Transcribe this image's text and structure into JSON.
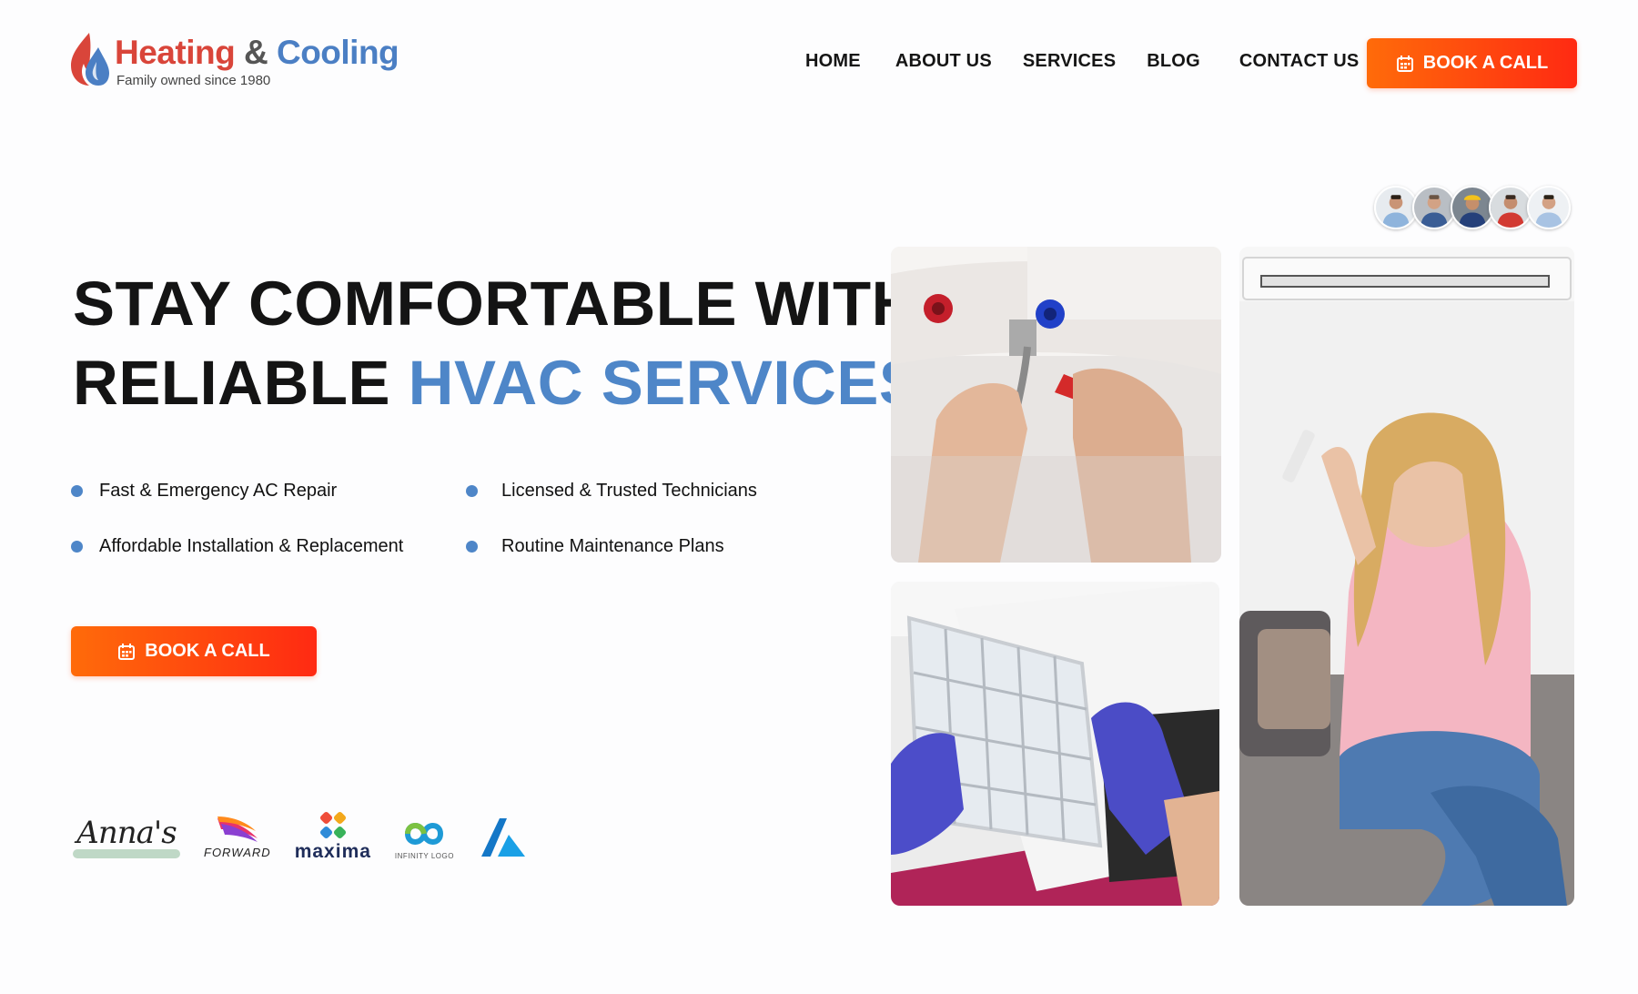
{
  "brand": {
    "title_part1": "Heating",
    "title_amp": " & ",
    "title_part2": "Cooling",
    "tagline": "Family owned since 1980",
    "logo_icon": "flame-drop-icon"
  },
  "nav": {
    "items": [
      "HOME",
      "ABOUT US",
      "SERVICES",
      "BLOG",
      "CONTACT US"
    ],
    "cta_label": "BOOK A CALL",
    "cta_icon": "calendar-icon"
  },
  "hero": {
    "headline_line1": "STAY COMFORTABLE WITH",
    "headline_line2_plain": "RELIABLE ",
    "headline_line2_accent": "HVAC SERVICES",
    "features": [
      "Fast & Emergency AC Repair",
      "Licensed & Trusted Technicians",
      "Affordable Installation & Replacement",
      "Routine Maintenance Plans"
    ],
    "cta_label": "BOOK A CALL"
  },
  "partners": {
    "annas": "Anna's",
    "forward": "FORWARD",
    "maxima": "maxima",
    "infinity": "INFINITY LOGO"
  },
  "team_avatars": [
    "technician-1",
    "technician-2",
    "technician-3",
    "technician-4",
    "technician-5"
  ],
  "gallery": [
    "plumber-repairing-water-heater",
    "technician-cleaning-ac-filter",
    "woman-relaxing-with-ac-remote"
  ],
  "colors": {
    "accent_blue": "#4e86c8",
    "cta_orange": "#ff6b0a",
    "cta_red": "#ff2a12",
    "text_dark": "#141414"
  }
}
